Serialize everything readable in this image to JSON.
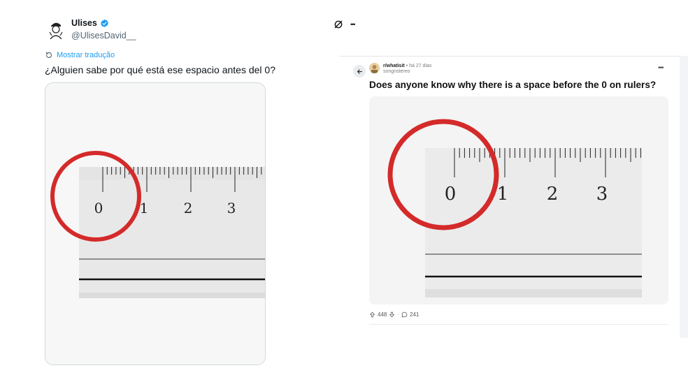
{
  "tweet": {
    "display_name": "Ulises",
    "handle": "@UlisesDavid__",
    "translate_label": "Mostrar tradução",
    "text": "¿Alguien sabe por qué está ese espacio antes del 0?",
    "ruler_labels": [
      "0",
      "1",
      "2",
      "3"
    ]
  },
  "reddit": {
    "subreddit": "r/whatisit",
    "time": "• há 27 dias",
    "username": "songnstereo",
    "title": "Does anyone know why there is a space before the 0 on rulers?",
    "upvotes": "448",
    "comments": "241",
    "more_label": "•••",
    "ruler_labels": [
      "0",
      "1",
      "2",
      "3"
    ]
  },
  "toolbar": {
    "more_label": "•••"
  },
  "colors": {
    "accent_blue": "#1d9bf0",
    "circle_red": "#d42a2a",
    "text_gray": "#536471"
  }
}
